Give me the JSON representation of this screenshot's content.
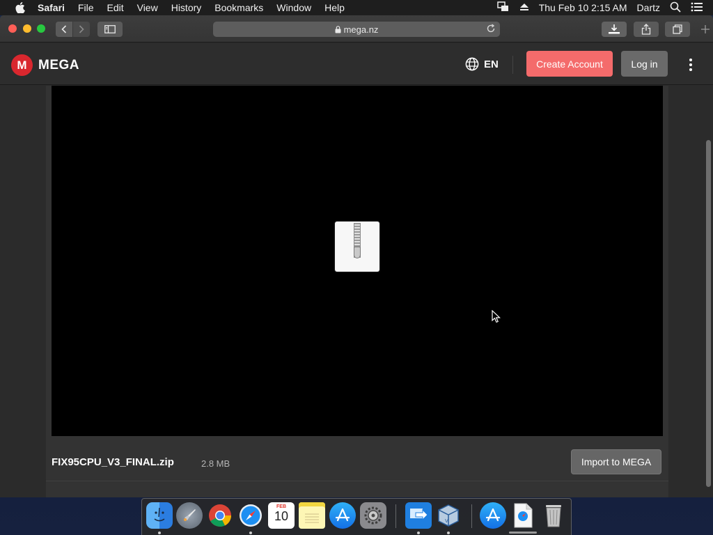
{
  "menubar": {
    "app_name": "Safari",
    "items": [
      "File",
      "Edit",
      "View",
      "History",
      "Bookmarks",
      "Window",
      "Help"
    ],
    "clock": "Thu Feb 10  2:15 AM",
    "user": "Dartz"
  },
  "browser": {
    "url": "mega.nz"
  },
  "header": {
    "logo_letter": "M",
    "logo_text": "MEGA",
    "language": "EN",
    "create_account": "Create Account",
    "login": "Log in"
  },
  "file": {
    "name": "FIX95CPU_V3_FINAL.zip",
    "size": "2.8 MB",
    "import_label": "Import to MEGA"
  },
  "dock": {
    "calendar_month": "FEB",
    "calendar_day": "10",
    "apps": [
      "finder-icon",
      "launchpad-icon",
      "chrome-icon",
      "safari-icon",
      "calendar-icon",
      "notes-icon",
      "app-store-icon",
      "system-preferences-icon",
      "migration-assistant-icon",
      "virtualbox-icon",
      "app-store-downloads-icon",
      "document-icon",
      "trash-icon"
    ]
  },
  "colors": {
    "mega_red": "#d9272e",
    "create_account_bg": "#f46b6b",
    "login_bg": "#6a6a6a",
    "import_bg": "#666666"
  }
}
